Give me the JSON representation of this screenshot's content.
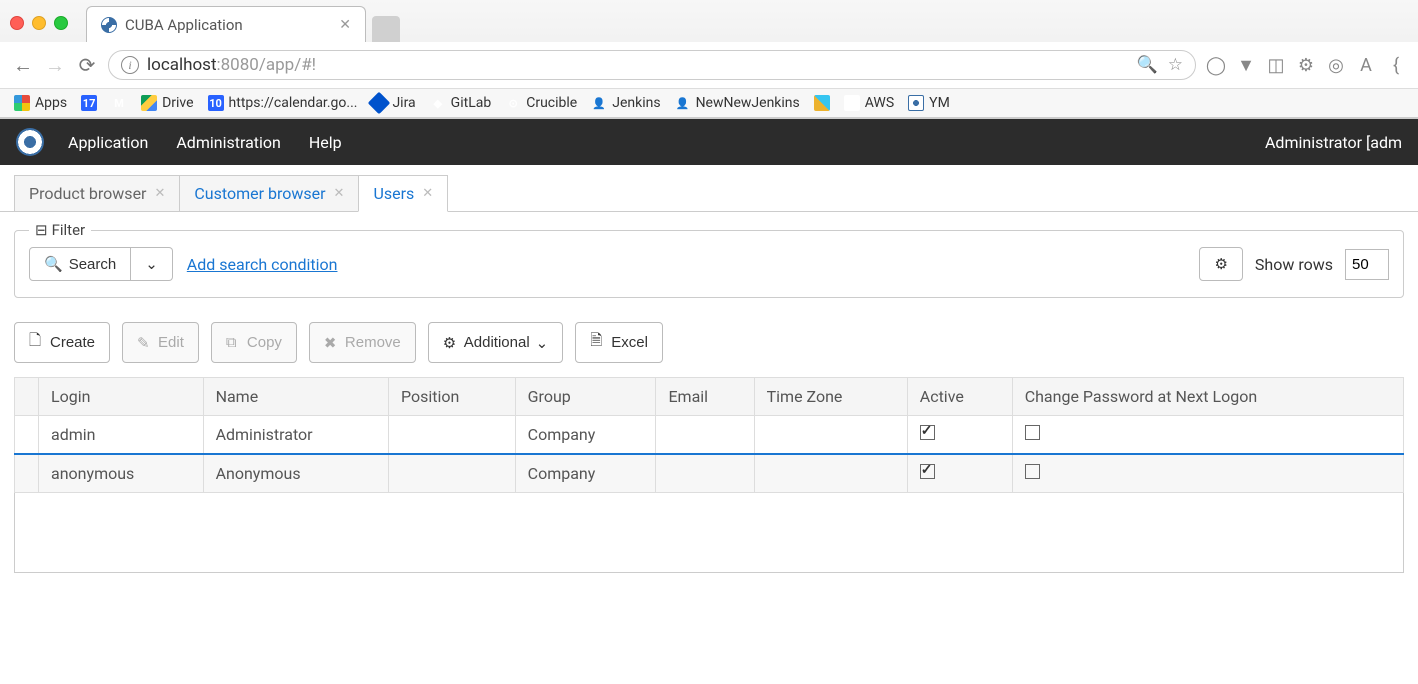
{
  "browser": {
    "tab_title": "CUBA Application",
    "url_host": "localhost",
    "url_rest": ":8080/app/#!"
  },
  "bookmarks": [
    {
      "label": "Apps",
      "icon": "apps"
    },
    {
      "label": "",
      "icon": "cal",
      "text": "17"
    },
    {
      "label": "",
      "icon": "gmail"
    },
    {
      "label": "Drive",
      "icon": "drive"
    },
    {
      "label": "https://calendar.go...",
      "icon": "cal2",
      "text": "10"
    },
    {
      "label": "Jira",
      "icon": "jira"
    },
    {
      "label": "GitLab",
      "icon": "gitlab"
    },
    {
      "label": "Crucible",
      "icon": "crucible"
    },
    {
      "label": "Jenkins",
      "icon": "jenkins"
    },
    {
      "label": "NewNewJenkins",
      "icon": "jenkins"
    },
    {
      "label": "",
      "icon": "slack"
    },
    {
      "label": "AWS",
      "icon": "google"
    },
    {
      "label": "YM",
      "icon": "cuba"
    }
  ],
  "header": {
    "menu": [
      "Application",
      "Administration",
      "Help"
    ],
    "user": "Administrator [adm"
  },
  "app_tabs": [
    {
      "label": "Product browser",
      "active": false,
      "link": false
    },
    {
      "label": "Customer browser",
      "active": false,
      "link": true
    },
    {
      "label": "Users",
      "active": true,
      "link": true
    }
  ],
  "filter": {
    "legend": "Filter",
    "search_label": "Search",
    "add_condition": "Add search condition",
    "show_rows_label": "Show rows",
    "show_rows_value": "50"
  },
  "actions": {
    "create": "Create",
    "edit": "Edit",
    "copy": "Copy",
    "remove": "Remove",
    "additional": "Additional",
    "excel": "Excel"
  },
  "table": {
    "columns": [
      "Login",
      "Name",
      "Position",
      "Group",
      "Email",
      "Time Zone",
      "Active",
      "Change Password at Next Logon"
    ],
    "rows": [
      {
        "login": "admin",
        "name": "Administrator",
        "position": "",
        "group": "Company",
        "email": "",
        "timezone": "",
        "active": true,
        "change_pw": false,
        "selected": true
      },
      {
        "login": "anonymous",
        "name": "Anonymous",
        "position": "",
        "group": "Company",
        "email": "",
        "timezone": "",
        "active": true,
        "change_pw": false,
        "selected": false
      }
    ]
  }
}
